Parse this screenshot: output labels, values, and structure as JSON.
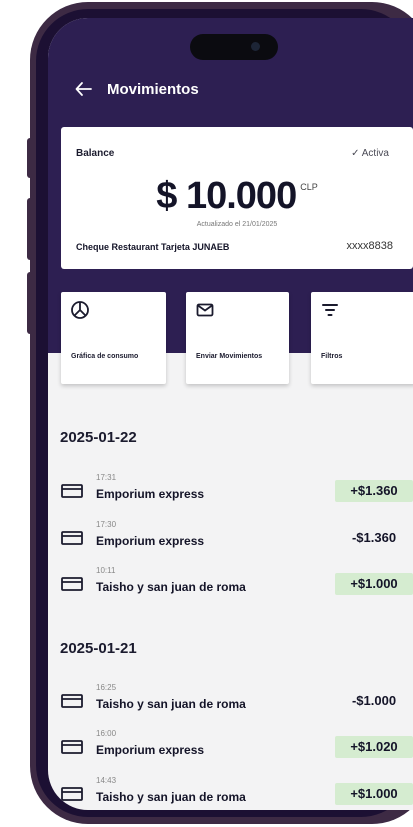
{
  "header": {
    "title": "Movimientos"
  },
  "balance": {
    "label": "Balance",
    "status": "✓ Activa",
    "amount": "$ 10.000",
    "currency": "CLP",
    "updated": "Actualizado el 21/01/2025",
    "card_name": "Cheque Restaurant Tarjeta JUNAEB",
    "card_number": "xxxx8838"
  },
  "actions": [
    {
      "label": "Gráfica de consumo",
      "icon": "pie-chart-icon"
    },
    {
      "label": "Enviar Movimientos",
      "icon": "envelope-icon"
    },
    {
      "label": "Filtros",
      "icon": "filter-icon"
    }
  ],
  "groups": [
    {
      "date": "2025-01-22",
      "transactions": [
        {
          "time": "17:31",
          "merchant": "Emporium express",
          "amount": "+$1.360",
          "type": "credit"
        },
        {
          "time": "17:30",
          "merchant": "Emporium express",
          "amount": "-$1.360",
          "type": "debit"
        },
        {
          "time": "10:11",
          "merchant": "Taisho y san juan de roma",
          "amount": "+$1.000",
          "type": "credit"
        }
      ]
    },
    {
      "date": "2025-01-21",
      "transactions": [
        {
          "time": "16:25",
          "merchant": "Taisho y san juan de roma",
          "amount": "-$1.000",
          "type": "debit"
        },
        {
          "time": "16:00",
          "merchant": "Emporium express",
          "amount": "+$1.020",
          "type": "credit"
        },
        {
          "time": "14:43",
          "merchant": "Taisho y san juan de roma",
          "amount": "+$1.000",
          "type": "credit"
        }
      ]
    }
  ],
  "colors": {
    "brand": "#2d1f52",
    "credit_bg": "#d5ecd0",
    "frame": "#3d2a44"
  }
}
